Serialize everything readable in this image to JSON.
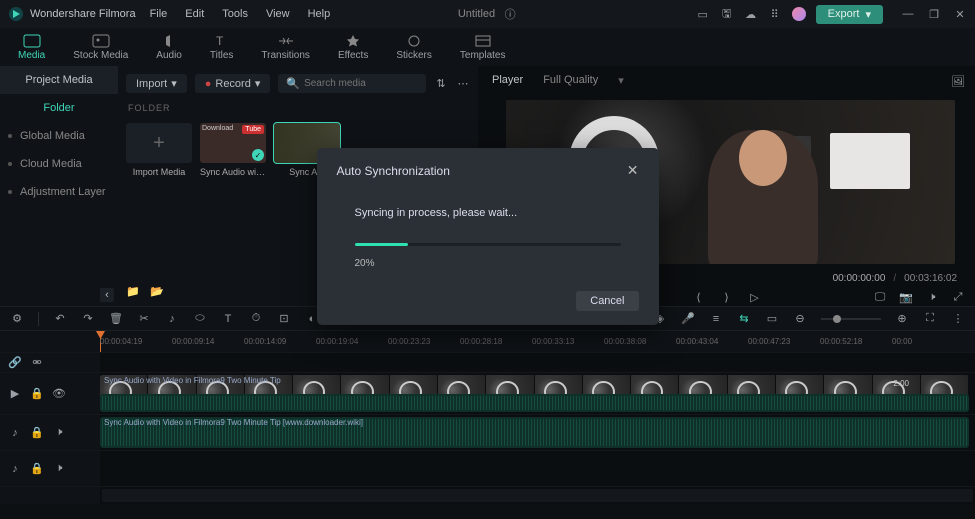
{
  "app_name": "Wondershare Filmora",
  "menu": [
    "File",
    "Edit",
    "Tools",
    "View",
    "Help"
  ],
  "project_title": "Untitled",
  "export_label": "Export",
  "tabs": [
    {
      "label": "Media",
      "active": true
    },
    {
      "label": "Stock Media",
      "active": false
    },
    {
      "label": "Audio",
      "active": false
    },
    {
      "label": "Titles",
      "active": false
    },
    {
      "label": "Transitions",
      "active": false
    },
    {
      "label": "Effects",
      "active": false
    },
    {
      "label": "Stickers",
      "active": false
    },
    {
      "label": "Templates",
      "active": false
    }
  ],
  "sidebar": {
    "header": "Project Media",
    "sub": "Folder",
    "items": [
      "Global Media",
      "Cloud Media",
      "Adjustment Layer"
    ]
  },
  "media_tools": {
    "import": "Import",
    "record": "Record",
    "search_placeholder": "Search media"
  },
  "folder_label": "FOLDER",
  "media_items": [
    {
      "label": "Import Media",
      "kind": "add"
    },
    {
      "label": "Sync Audio with...",
      "kind": "clip",
      "download": "Download",
      "tag": "Tube"
    },
    {
      "label": "Sync A...",
      "kind": "clip",
      "selected": true
    }
  ],
  "preview": {
    "tabs": [
      "Player",
      "Full Quality"
    ],
    "current": "00:00:00:00",
    "total": "00:03:16:02"
  },
  "ruler_marks": [
    "00:00:04:19",
    "00:00:09:14",
    "00:00:14:09",
    "00:00:19:04",
    "00:00:23:23",
    "00:00:28:18",
    "00:00:33:13",
    "00:00:38:08",
    "00:00:43:04",
    "00:00:47:23",
    "00:00:52:18",
    "00:00"
  ],
  "track_clips": {
    "video_label": "Sync Audio with Video in Filmora9 Two Minute Tip",
    "video_time": "2:00",
    "audio_label": "Sync Audio with Video in Filmora9 Two Minute Tip [www.downloader.wiki]"
  },
  "modal": {
    "title": "Auto Synchronization",
    "message": "Syncing in process, please wait...",
    "percent": 20,
    "percent_label": "20%",
    "cancel": "Cancel"
  }
}
